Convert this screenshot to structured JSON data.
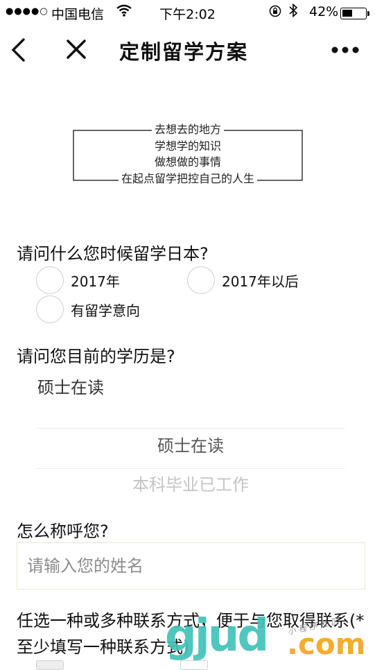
{
  "status_bar": {
    "signal": "●●●●○",
    "carrier": "中国电信",
    "time": "下午2:02",
    "battery": "42%"
  },
  "nav": {
    "title": "定制留学方案",
    "icons": [
      "back-icon",
      "close-icon",
      "more-icon"
    ]
  },
  "slogan": {
    "lines": [
      "去想去的地方",
      "学想学的知识",
      "做想做的事情",
      "在起点留学把控自己的人生"
    ]
  },
  "question1": {
    "label": "请问什么您时候留学日本?",
    "options": [
      "2017年",
      "2017年以后",
      "有留学意向"
    ]
  },
  "question2": {
    "label": "请问您目前的学历是?",
    "selected": "硕士在读",
    "picker_items": [
      "硕士在读",
      "本科毕业已工作"
    ]
  },
  "question3": {
    "label": "怎么称呼您?",
    "placeholder": "请输入您的姓名"
  },
  "contact": {
    "text": "任选一种或多种联系方式，便于与您取得联系(*至少填写一种联系方式)"
  },
  "watermark": {
    "main": "gjud",
    "com": ".com",
    "small": "小 程 序 社 区"
  },
  "colors": {
    "radio_border": "#cfcfcf",
    "input_border": "#e2ecd3",
    "watermark_teal": "#41c3b9",
    "watermark_orange": "#f5a51e"
  }
}
